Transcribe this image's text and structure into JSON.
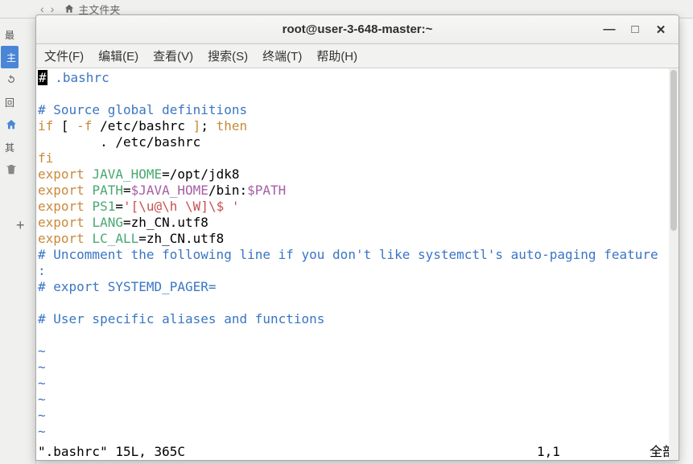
{
  "bg": {
    "home_label": "主文件夹",
    "side": {
      "l1": "最",
      "l2": "主",
      "l3": "回",
      "l4": "其"
    }
  },
  "window": {
    "title": "root@user-3-648-master:~"
  },
  "menu": {
    "file": "文件(F)",
    "edit": "编辑(E)",
    "view": "查看(V)",
    "search": "搜索(S)",
    "terminal": "终端(T)",
    "help": "帮助(H)"
  },
  "vim": {
    "lines": {
      "l1a": "#",
      "l1b": " .bashrc",
      "l3": "# Source global definitions",
      "l4a": "if",
      "l4b": " [ ",
      "l4c": "-f",
      "l4d": " /etc/bashrc ",
      "l4e": "]",
      "l4f": "; ",
      "l4g": "then",
      "l5": "        . /etc/bashrc",
      "l6": "fi",
      "l7a": "export",
      "l7b": " ",
      "l7c": "JAVA_HOME",
      "l7d": "=",
      "l7e": "/opt/jdk8",
      "l8a": "export",
      "l8b": " ",
      "l8c": "PATH",
      "l8d": "=",
      "l8e": "$JAVA_HOME",
      "l8f": "/bin:",
      "l8g": "$PATH",
      "l9a": "export",
      "l9b": " ",
      "l9c": "PS1",
      "l9d": "=",
      "l9e": "'[\\u@\\h \\W]\\$ '",
      "l10a": "export",
      "l10b": " ",
      "l10c": "LANG",
      "l10d": "=",
      "l10e": "zh_CN.utf8",
      "l11a": "export",
      "l11b": " ",
      "l11c": "LC_ALL",
      "l11d": "=",
      "l11e": "zh_CN.utf8",
      "l12": "# Uncomment the following line if you don't like systemctl's auto-paging feature",
      "l12b": ":",
      "l13": "# export SYSTEMD_PAGER=",
      "l15": "# User specific aliases and functions",
      "tilde": "~"
    },
    "status": {
      "left": "\".bashrc\" 15L, 365C",
      "pos": "1,1",
      "right": "全部"
    }
  }
}
